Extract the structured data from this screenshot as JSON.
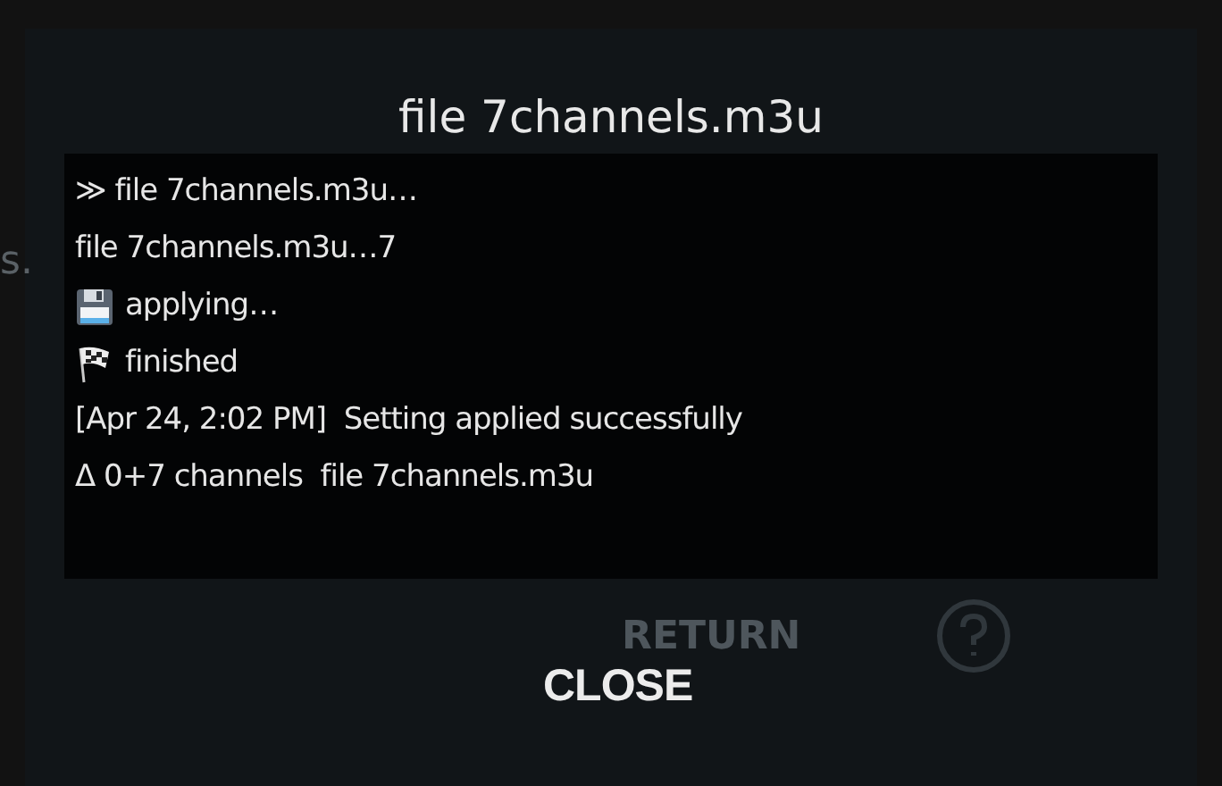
{
  "background": {
    "side_text": "s.",
    "return_label": "RETURN"
  },
  "dialog": {
    "title": "file 7channels.m3u",
    "log_lines": [
      {
        "kind": "plain",
        "text": "≫ file 7channels.m3u…"
      },
      {
        "kind": "plain",
        "text": "file 7channels.m3u…7"
      },
      {
        "kind": "save",
        "text": "applying…"
      },
      {
        "kind": "finish",
        "text": "finished"
      },
      {
        "kind": "plain",
        "text": "[Apr 24, 2:02 PM]  Setting applied successfully"
      },
      {
        "kind": "plain",
        "text": "Δ 0+7 channels  file 7channels.m3u"
      }
    ],
    "buttons": [
      "CLOSE"
    ]
  }
}
